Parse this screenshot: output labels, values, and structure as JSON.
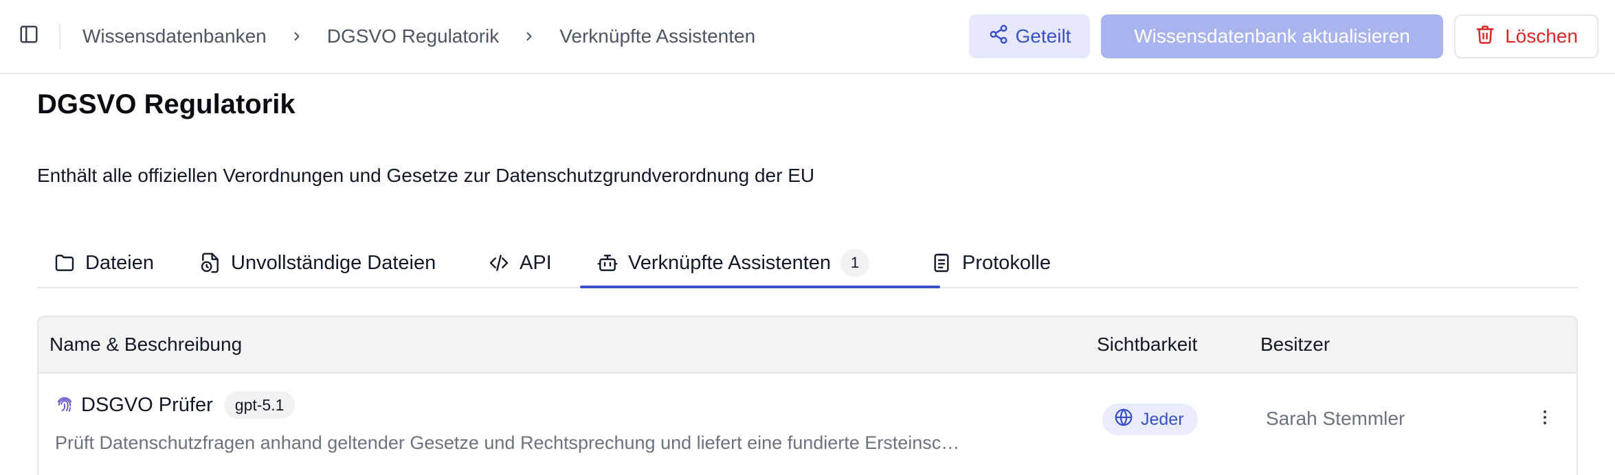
{
  "header": {
    "breadcrumb": [
      "Wissensdatenbanken",
      "DGSVO Regulatorik",
      "Verknüpfte Assistenten"
    ],
    "shared_label": "Geteilt",
    "update_label": "Wissensdatenbank aktualisieren",
    "delete_label": "Löschen"
  },
  "page": {
    "title": "DGSVO Regulatorik",
    "description": "Enthält alle offiziellen Verordnungen und Gesetze zur Datenschutzgrundverordnung der EU"
  },
  "tabs": [
    {
      "label": "Dateien",
      "icon": "folder-icon"
    },
    {
      "label": "Unvollständige Dateien",
      "icon": "file-clock-icon"
    },
    {
      "label": "API",
      "icon": "code-icon"
    },
    {
      "label": "Verknüpfte Assistenten",
      "icon": "bot-icon",
      "badge": "1",
      "active": true
    },
    {
      "label": "Protokolle",
      "icon": "clipboard-list-icon"
    }
  ],
  "table": {
    "columns": [
      "Name & Beschreibung",
      "Sichtbarkeit",
      "Besitzer"
    ],
    "rows": [
      {
        "name": "DSGVO Prüfer",
        "model": "gpt-5.1",
        "description": "Prüft Datenschutzfragen anhand geltender Gesetze und Rechtsprechung und liefert eine fundierte Ersteinsc…",
        "visibility": "Jeder",
        "owner": "Sarah Stemmler"
      }
    ]
  },
  "colors": {
    "accent": "#3b4fc8",
    "shared_bg": "#e5e9fb",
    "update_bg": "#a9b4ef",
    "danger": "#dc2626"
  }
}
